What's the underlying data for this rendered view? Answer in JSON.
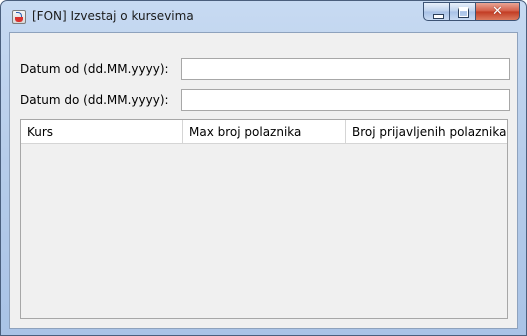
{
  "window": {
    "title": "[FON] Izvestaj o kursevima",
    "icon": "java-cup-icon",
    "controls": [
      "minimize",
      "maximize",
      "close"
    ]
  },
  "form": {
    "date_from": {
      "label": "Datum od (dd.MM.yyyy):",
      "value": ""
    },
    "date_to": {
      "label": "Datum do (dd.MM.yyyy):",
      "value": ""
    }
  },
  "table": {
    "columns": [
      "Kurs",
      "Max broj polaznika",
      "Broj prijavljenih polaznika"
    ],
    "rows": []
  },
  "colors": {
    "title_bar": "#b7cdea",
    "close_button": "#c13a22",
    "panel_background": "#f0f0f0"
  }
}
